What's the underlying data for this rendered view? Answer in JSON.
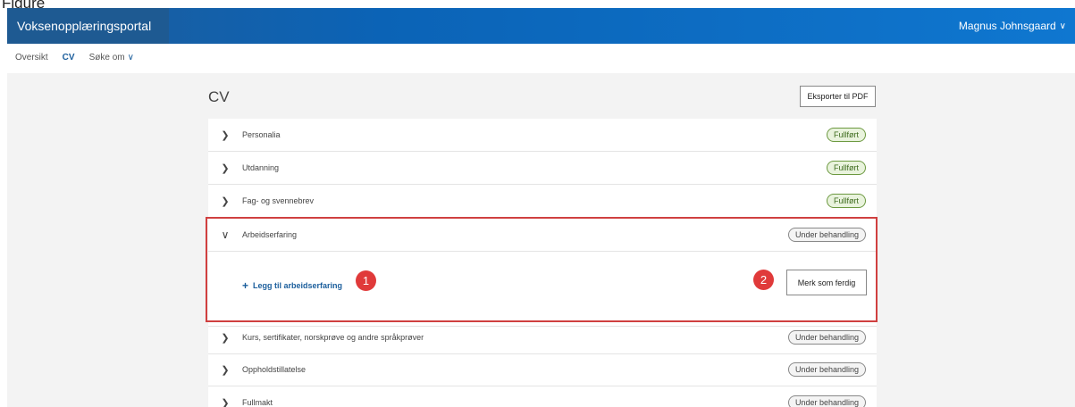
{
  "caption": "Figure",
  "header": {
    "brand": "Voksenopplæringsportal",
    "user_name": "Magnus Johnsgaard",
    "user_chevron": "∨"
  },
  "subnav": {
    "items": [
      "Oversikt",
      "CV",
      "Søke om"
    ],
    "menu_chevron": "∨"
  },
  "page": {
    "title": "CV",
    "export_label": "Eksporter til PDF"
  },
  "sections": [
    {
      "label": "Personalia",
      "status": "Fullført",
      "state": "done",
      "expanded": false
    },
    {
      "label": "Utdanning",
      "status": "Fullført",
      "state": "done",
      "expanded": false
    },
    {
      "label": "Fag- og svennebrev",
      "status": "Fullført",
      "state": "done",
      "expanded": false
    },
    {
      "label": "Arbeidserfaring",
      "status": "Under behandling",
      "state": "pending",
      "expanded": true
    },
    {
      "label": "Kurs, sertifikater, norskprøve og andre språkprøver",
      "status": "Under behandling",
      "state": "pending",
      "expanded": false
    },
    {
      "label": "Oppholdstillatelse",
      "status": "Under behandling",
      "state": "pending",
      "expanded": false
    },
    {
      "label": "Fullmakt",
      "status": "Under behandling",
      "state": "pending",
      "expanded": false
    }
  ],
  "expanded": {
    "add_label": "Legg til arbeidserfaring",
    "mark_done_label": "Merk som ferdig"
  },
  "markers": [
    "1",
    "2"
  ],
  "icons": {
    "collapsed_arrow": "chevron-right-icon",
    "expanded_arrow": "chevron-down-icon",
    "add": "plus-icon"
  },
  "colors": {
    "header_blue": "#0b63b6",
    "link_blue": "#1b5e9c",
    "done_green": "#6c9940",
    "highlight_red": "#d04040"
  }
}
